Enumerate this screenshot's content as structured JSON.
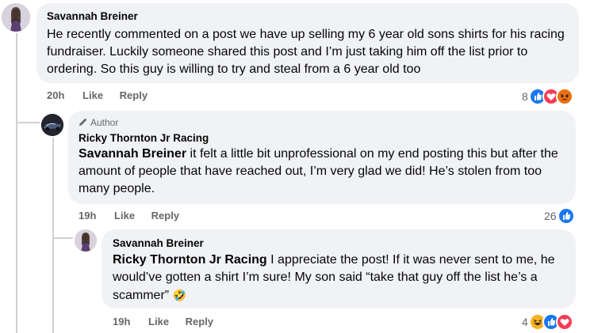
{
  "comments": [
    {
      "author": "Savannah Breiner",
      "text": "He recently commented on a post we have up selling my 6 year old sons shirts for his racing fundraiser. Luckily someone shared this post and I’m just taking him off the list prior to ordering. So this guy is willing to try and steal from a 6 year old too",
      "time": "20h",
      "like_label": "Like",
      "reply_label": "Reply",
      "reaction_count": "8",
      "reactions": [
        "like-icon",
        "love-icon",
        "angry-icon"
      ]
    },
    {
      "author_badge": "Author",
      "author": "Ricky Thornton Jr Racing",
      "mention": "Savannah Breiner",
      "text": " it felt a little bit unprofessional on my end posting this but after the amount of people that have reached out, I’m very glad we did! He’s stolen from too many people.",
      "time": "19h",
      "like_label": "Like",
      "reply_label": "Reply",
      "reaction_count": "26",
      "reactions": [
        "like-icon"
      ]
    },
    {
      "author": "Savannah Breiner",
      "mention": "Ricky Thornton Jr Racing",
      "text": " I appreciate the post! If it was never sent to me, he would’ve gotten a shirt I’m sure! My son said “take that guy off the list he’s a scammer” ",
      "emoji": "🤣",
      "time": "19h",
      "like_label": "Like",
      "reply_label": "Reply",
      "reaction_count": "4",
      "reactions": [
        "haha-icon",
        "like-icon",
        "love-icon"
      ]
    }
  ],
  "colors": {
    "bubble": "#f0f2f5",
    "like_blue": "#1877f2",
    "love_red": "#f33e58",
    "angry_orange": "#e9710f",
    "haha_yellow": "#f7b125",
    "thread_line": "#ced0d4"
  }
}
